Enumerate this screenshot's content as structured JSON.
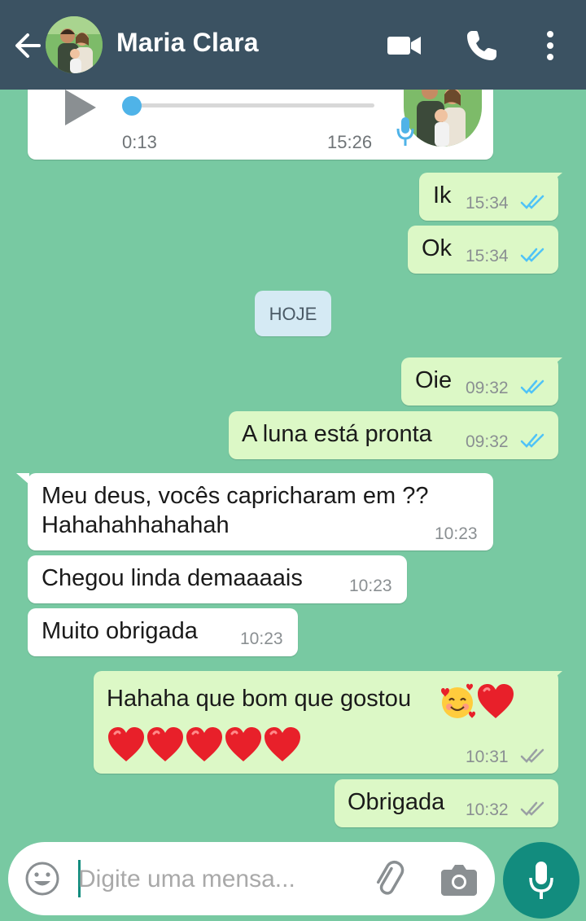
{
  "header": {
    "contact_name": "Maria Clara",
    "background": "#3b5262",
    "icons": [
      "back-arrow-icon",
      "video-call-icon",
      "voice-call-icon",
      "more-options-icon"
    ]
  },
  "voice_message": {
    "duration": "0:13",
    "time": "15:26",
    "progress": 0
  },
  "day_separator": "HOJE",
  "messages": [
    {
      "dir": "out",
      "text": "Ik",
      "time": "15:34",
      "status": "read"
    },
    {
      "dir": "out",
      "text": "Ok",
      "time": "15:34",
      "status": "read"
    },
    {
      "dir": "out",
      "text": "Oie",
      "time": "09:32",
      "status": "read"
    },
    {
      "dir": "out",
      "text": "A luna está pronta",
      "time": "09:32",
      "status": "read"
    },
    {
      "dir": "in",
      "text_line1": "Meu deus, vocês capricharam em ??",
      "text_line2": "Hahahahhahahah",
      "time": "10:23"
    },
    {
      "dir": "in",
      "text": "Chegou linda demaaaais",
      "time": "10:23"
    },
    {
      "dir": "in",
      "text": "Muito obrigada",
      "time": "10:23"
    },
    {
      "dir": "out",
      "text_line1": "Hahaha que bom que gostou",
      "emoji_line1": [
        "smiling-face-with-hearts",
        "red-heart"
      ],
      "emoji_line2": [
        "red-heart",
        "red-heart",
        "red-heart",
        "red-heart",
        "red-heart"
      ],
      "time": "10:31",
      "status": "delivered"
    },
    {
      "dir": "out",
      "text": "Obrigada",
      "time": "10:32",
      "status": "delivered"
    }
  ],
  "composer": {
    "placeholder": "Digite uma mensa..."
  },
  "colors": {
    "chat_background": "#78c9a2",
    "outgoing_bubble": "#dcf8c6",
    "incoming_bubble": "#ffffff",
    "read_ticks": "#4fc3f7",
    "delivered_ticks": "#9aa0a4",
    "accent": "#128c7e"
  }
}
